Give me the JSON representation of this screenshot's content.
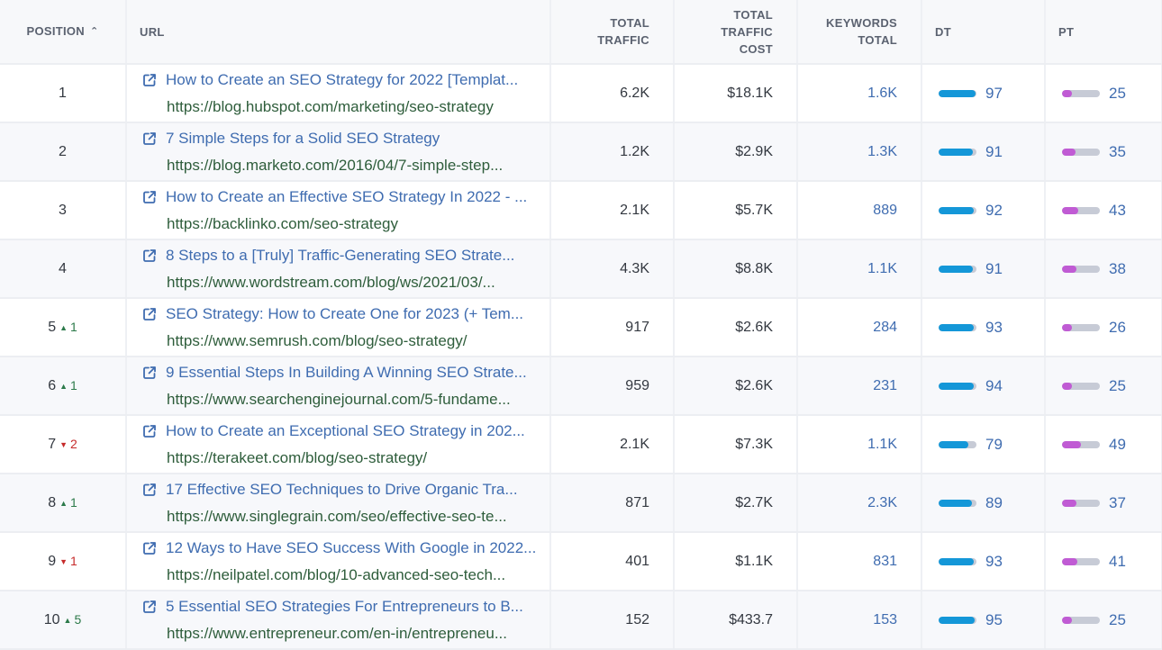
{
  "colors": {
    "dt_bar": "#1497d8",
    "pt_bar": "#c05bd4",
    "bar_track": "#c7cbd6",
    "link_blue": "#3f6cb0",
    "url_green": "#2e5d3b",
    "delta_up": "#2c7a4a",
    "delta_down": "#c62b2b"
  },
  "table": {
    "headers": {
      "position": "POSITION",
      "position_sort_icon": "chevron-up-icon",
      "url": "URL",
      "total_traffic": "TOTAL TRAFFIC",
      "total_traffic_cost": "TOTAL TRAFFIC COST",
      "keywords_total": "KEYWORDS TOTAL",
      "dt": "DT",
      "pt": "PT"
    },
    "rows": [
      {
        "position": "1",
        "delta": "",
        "delta_dir": "",
        "title": "How to Create an SEO Strategy for 2022 [Templat...",
        "url": "https://blog.hubspot.com/marketing/seo-strategy",
        "total_traffic": "6.2K",
        "total_traffic_cost": "$18.1K",
        "keywords_total": "1.6K",
        "dt": 97,
        "pt": 25
      },
      {
        "position": "2",
        "delta": "",
        "delta_dir": "",
        "title": "7 Simple Steps for a Solid SEO Strategy",
        "url": "https://blog.marketo.com/2016/04/7-simple-step...",
        "total_traffic": "1.2K",
        "total_traffic_cost": "$2.9K",
        "keywords_total": "1.3K",
        "dt": 91,
        "pt": 35
      },
      {
        "position": "3",
        "delta": "",
        "delta_dir": "",
        "title": "How to Create an Effective SEO Strategy In 2022 - ...",
        "url": "https://backlinko.com/seo-strategy",
        "total_traffic": "2.1K",
        "total_traffic_cost": "$5.7K",
        "keywords_total": "889",
        "dt": 92,
        "pt": 43
      },
      {
        "position": "4",
        "delta": "",
        "delta_dir": "",
        "title": "8 Steps to a [Truly] Traffic-Generating SEO Strate...",
        "url": "https://www.wordstream.com/blog/ws/2021/03/...",
        "total_traffic": "4.3K",
        "total_traffic_cost": "$8.8K",
        "keywords_total": "1.1K",
        "dt": 91,
        "pt": 38
      },
      {
        "position": "5",
        "delta": "1",
        "delta_dir": "up",
        "title": "SEO Strategy: How to Create One for 2023 (+ Tem...",
        "url": "https://www.semrush.com/blog/seo-strategy/",
        "total_traffic": "917",
        "total_traffic_cost": "$2.6K",
        "keywords_total": "284",
        "dt": 93,
        "pt": 26
      },
      {
        "position": "6",
        "delta": "1",
        "delta_dir": "up",
        "title": "9 Essential Steps In Building A Winning SEO Strate...",
        "url": "https://www.searchenginejournal.com/5-fundame...",
        "total_traffic": "959",
        "total_traffic_cost": "$2.6K",
        "keywords_total": "231",
        "dt": 94,
        "pt": 25
      },
      {
        "position": "7",
        "delta": "2",
        "delta_dir": "down",
        "title": "How to Create an Exceptional SEO Strategy in 202...",
        "url": "https://terakeet.com/blog/seo-strategy/",
        "total_traffic": "2.1K",
        "total_traffic_cost": "$7.3K",
        "keywords_total": "1.1K",
        "dt": 79,
        "pt": 49
      },
      {
        "position": "8",
        "delta": "1",
        "delta_dir": "up",
        "title": "17 Effective SEO Techniques to Drive Organic Tra...",
        "url": "https://www.singlegrain.com/seo/effective-seo-te...",
        "total_traffic": "871",
        "total_traffic_cost": "$2.7K",
        "keywords_total": "2.3K",
        "dt": 89,
        "pt": 37
      },
      {
        "position": "9",
        "delta": "1",
        "delta_dir": "down",
        "title": "12 Ways to Have SEO Success With Google in 2022...",
        "url": "https://neilpatel.com/blog/10-advanced-seo-tech...",
        "total_traffic": "401",
        "total_traffic_cost": "$1.1K",
        "keywords_total": "831",
        "dt": 93,
        "pt": 41
      },
      {
        "position": "10",
        "delta": "5",
        "delta_dir": "up",
        "title": "5 Essential SEO Strategies For Entrepreneurs to B...",
        "url": "https://www.entrepreneur.com/en-in/entrepreneu...",
        "total_traffic": "152",
        "total_traffic_cost": "$433.7",
        "keywords_total": "153",
        "dt": 95,
        "pt": 25
      }
    ]
  }
}
